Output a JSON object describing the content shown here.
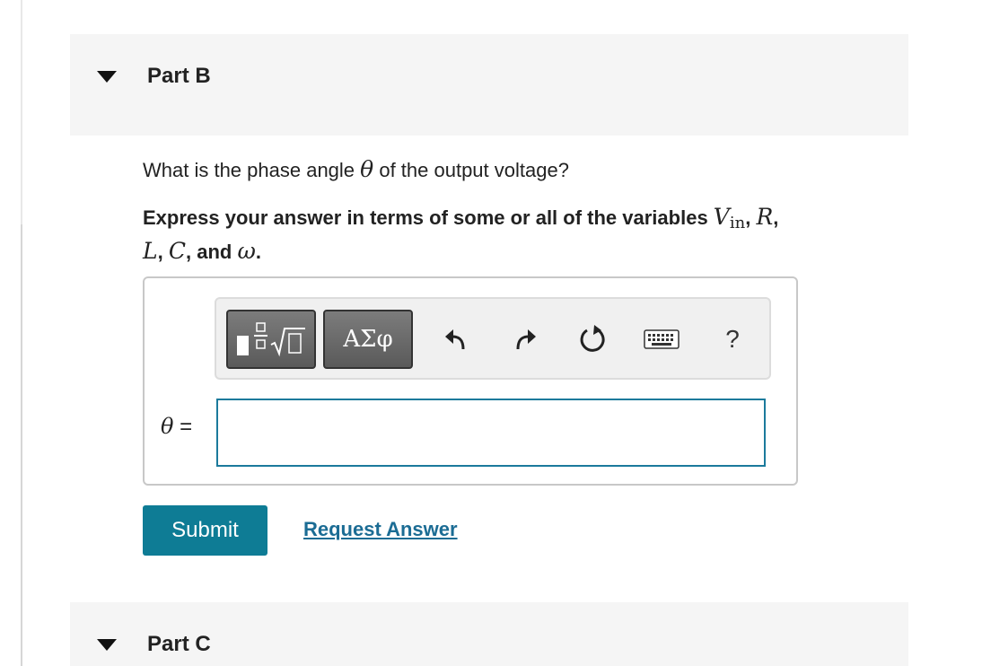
{
  "part_b": {
    "title": "Part B"
  },
  "part_c": {
    "title": "Part C"
  },
  "question": {
    "text_before": "What is the phase angle ",
    "symbol": "θ",
    "text_after": " of the output voltage?"
  },
  "instructions": {
    "text": "Express your answer in terms of some or all of the variables ",
    "var_v": "V",
    "var_v_sub": "in",
    "sep1": ", ",
    "var_r": "R",
    "sep2": ",",
    "var_l": "L",
    "sep3": ", ",
    "var_c": "C",
    "sep4": ", and ",
    "var_w": "ω",
    "end": "."
  },
  "toolbar": {
    "templates_icon": "fraction-sqrt-template-icon",
    "greek_label": "ΑΣφ",
    "undo_icon": "undo-icon",
    "redo_icon": "redo-icon",
    "reset_icon": "reset-icon",
    "keyboard_icon": "keyboard-icon",
    "help_label": "?"
  },
  "answer": {
    "symbol": "θ",
    "equals": " =",
    "value": ""
  },
  "actions": {
    "submit_label": "Submit",
    "request_label": "Request Answer"
  },
  "colors": {
    "accent": "#0e7c95",
    "link": "#1b6c94",
    "input_border": "#1b7a9c",
    "header_bg": "#f5f5f5"
  }
}
